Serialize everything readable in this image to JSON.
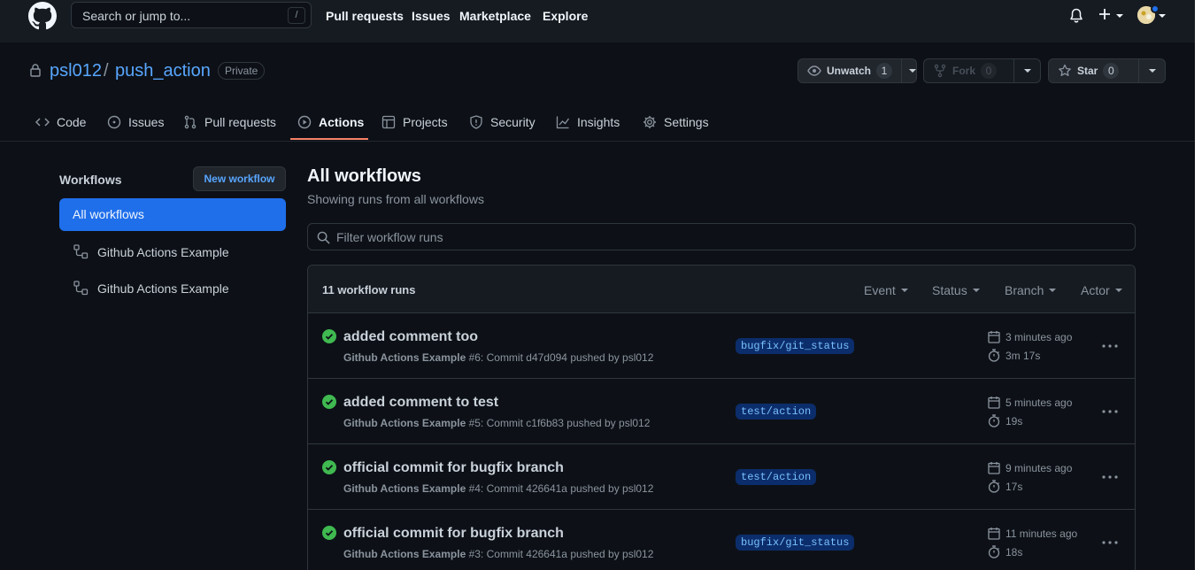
{
  "topbar": {
    "search_placeholder": "Search or jump to...",
    "search_key": "/",
    "nav": [
      "Pull requests",
      "Issues",
      "Marketplace",
      "Explore"
    ]
  },
  "repo": {
    "owner": "psl012",
    "separator": "/",
    "name": "push_action",
    "visibility": "Private",
    "unwatch_label": "Unwatch",
    "unwatch_count": "1",
    "fork_label": "Fork",
    "fork_count": "0",
    "star_label": "Star",
    "star_count": "0"
  },
  "tabs": [
    {
      "label": "Code",
      "icon": "code-icon"
    },
    {
      "label": "Issues",
      "icon": "issue-icon"
    },
    {
      "label": "Pull requests",
      "icon": "pull-request-icon"
    },
    {
      "label": "Actions",
      "icon": "play-icon",
      "active": true
    },
    {
      "label": "Projects",
      "icon": "project-icon"
    },
    {
      "label": "Security",
      "icon": "shield-icon"
    },
    {
      "label": "Insights",
      "icon": "graph-icon"
    },
    {
      "label": "Settings",
      "icon": "gear-icon"
    }
  ],
  "sidebar": {
    "title": "Workflows",
    "new_workflow": "New workflow",
    "items": [
      "All workflows",
      "Github Actions Example",
      "Github Actions Example"
    ]
  },
  "main": {
    "title": "All workflows",
    "subtitle": "Showing runs from all workflows",
    "filter_placeholder": "Filter workflow runs",
    "runs_count": "11 workflow runs",
    "filters": [
      "Event",
      "Status",
      "Branch",
      "Actor"
    ],
    "runs": [
      {
        "title": "added comment too",
        "workflow": "Github Actions Example",
        "meta": " #6: Commit d47d094 pushed by psl012",
        "branch": "bugfix/git_status",
        "when": "3 minutes ago",
        "duration": "3m 17s"
      },
      {
        "title": "added comment to test",
        "workflow": "Github Actions Example",
        "meta": " #5: Commit c1f6b83 pushed by psl012",
        "branch": "test/action",
        "when": "5 minutes ago",
        "duration": "19s"
      },
      {
        "title": "official commit for bugfix branch",
        "workflow": "Github Actions Example",
        "meta": " #4: Commit 426641a pushed by psl012",
        "branch": "test/action",
        "when": "9 minutes ago",
        "duration": "17s"
      },
      {
        "title": "official commit for bugfix branch",
        "workflow": "Github Actions Example",
        "meta": " #3: Commit 426641a pushed by psl012",
        "branch": "bugfix/git_status",
        "when": "11 minutes ago",
        "duration": "18s"
      }
    ]
  },
  "colors": {
    "accent": "#58a6ff",
    "active_tab_underline": "#f78166",
    "success": "#3fb950",
    "selected_bg": "#1f6feb"
  }
}
